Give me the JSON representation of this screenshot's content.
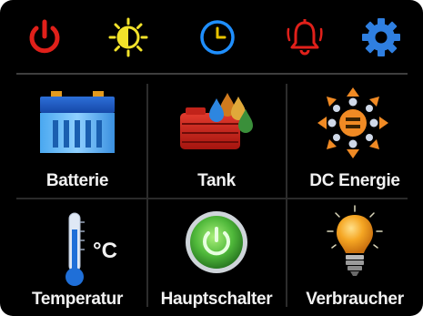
{
  "topbar": {
    "icons": [
      {
        "name": "power-icon",
        "color": "#e0201a"
      },
      {
        "name": "brightness-icon",
        "color": "#f2e22a"
      },
      {
        "name": "clock-icon",
        "color": "#1f8fff"
      },
      {
        "name": "alarm-bell-icon",
        "color": "#e0201a"
      },
      {
        "name": "settings-gear-icon",
        "color": "#2f7fe0"
      }
    ]
  },
  "tiles": {
    "battery": {
      "label": "Batterie",
      "icon": "battery-icon"
    },
    "tank": {
      "label": "Tank",
      "icon": "tank-icon"
    },
    "dc_energy": {
      "label": "DC Energie",
      "icon": "dc-energy-icon"
    },
    "temperature": {
      "label": "Temperatur",
      "icon": "thermometer-icon",
      "unit": "°C"
    },
    "main_switch": {
      "label": "Hauptschalter",
      "icon": "main-switch-icon"
    },
    "consumers": {
      "label": "Verbraucher",
      "icon": "light-bulb-icon"
    }
  }
}
